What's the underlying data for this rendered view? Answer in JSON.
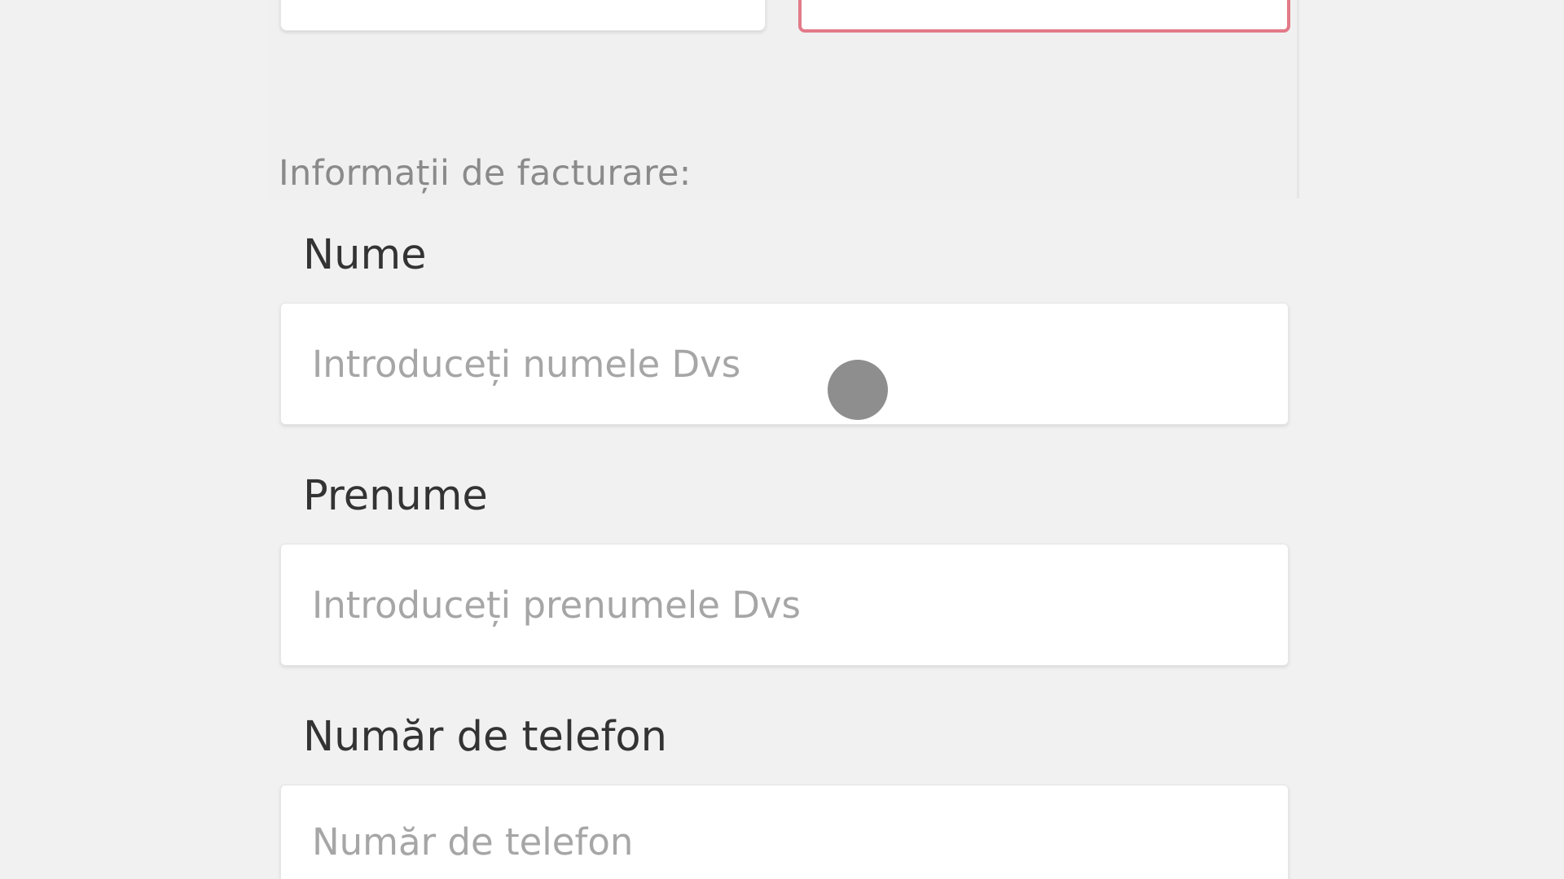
{
  "billing": {
    "heading": "Informații de facturare:",
    "fields": [
      {
        "label": "Nume",
        "placeholder": "Introduceți numele Dvs",
        "value": ""
      },
      {
        "label": "Prenume",
        "placeholder": "Introduceți prenumele Dvs",
        "value": ""
      },
      {
        "label": "Număr de telefon",
        "placeholder": "Număr de telefon",
        "value": ""
      }
    ]
  },
  "colors": {
    "background": "#f1f1f1",
    "input_background": "#ffffff",
    "error_border": "#e27a88",
    "label_text": "#333333",
    "placeholder_text": "#a6a6a6",
    "heading_text": "#8a8a8a",
    "touch_indicator": "#8e8e8e"
  }
}
